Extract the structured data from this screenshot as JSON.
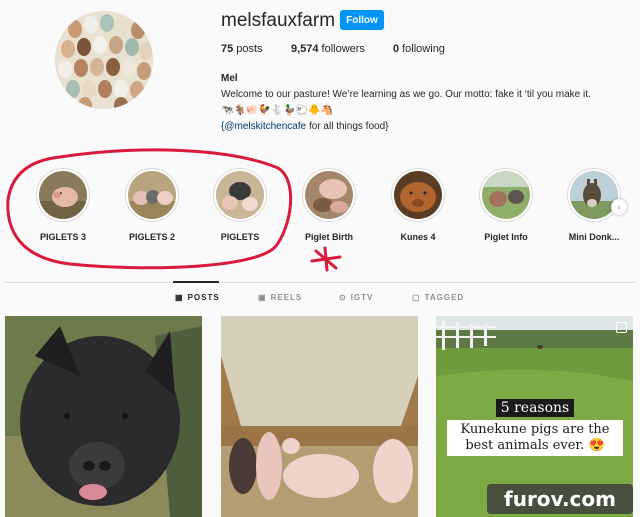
{
  "profile": {
    "username": "melsfauxfarm",
    "follow_label": "Follow",
    "posts_count": "75",
    "posts_label": "posts",
    "followers_count": "9,574",
    "followers_label": "followers",
    "following_count": "0",
    "following_label": "following",
    "display_name": "Mel",
    "bio_line": "Welcome to our pasture! We’re learning as we go. Our motto: fake it ‘til you make it.",
    "emoji_line": "🐄🐐🐖🐓🐇🦆🐑🐥🐴",
    "mention_line_tag": "{@melskitchencafe",
    "mention_line_rest": " for all things food}"
  },
  "highlights": [
    {
      "label": "PIGLETS 3"
    },
    {
      "label": "PIGLETS 2"
    },
    {
      "label": "PIGLETS"
    },
    {
      "label": "Piglet Birth"
    },
    {
      "label": "Kunes 4"
    },
    {
      "label": "Piglet Info"
    },
    {
      "label": "Mini Donk..."
    }
  ],
  "tabs": [
    {
      "label": "POSTS",
      "icon": "grid-icon"
    },
    {
      "label": "REELS",
      "icon": "reels-icon"
    },
    {
      "label": "IGTV",
      "icon": "igtv-icon"
    },
    {
      "label": "TAGGED",
      "icon": "tagged-icon"
    }
  ],
  "posts": {
    "caption_line1": "5 reasons",
    "caption_line2": "Kunekune pigs are the best animals ever. 😍"
  },
  "watermark": "furov.com",
  "colors": {
    "accent": "#0095f6",
    "annotation": "#d91a3c"
  }
}
